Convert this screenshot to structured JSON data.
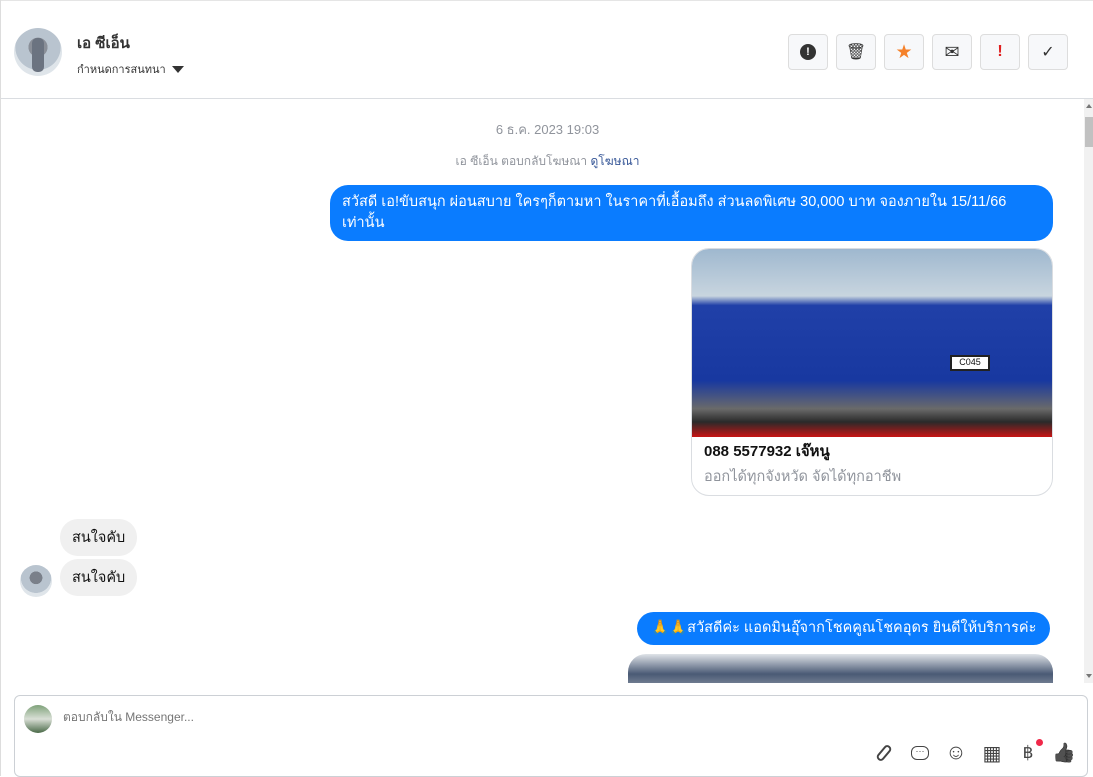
{
  "header": {
    "name": "เอ ซีเอ็น",
    "assign_label": "กำหนดการสนทนา",
    "actions": [
      {
        "icon": "alert-circle-icon",
        "glyph": "❗"
      },
      {
        "icon": "trash-icon",
        "glyph": "🗑"
      },
      {
        "icon": "star-icon",
        "glyph": "★",
        "color": "#f5812a"
      },
      {
        "icon": "envelope-icon",
        "glyph": "✉"
      },
      {
        "icon": "exclamation-icon",
        "glyph": "!",
        "color": "#e02020"
      },
      {
        "icon": "check-icon",
        "glyph": "✓"
      }
    ]
  },
  "chat": {
    "timestamp": "6 ธ.ค. 2023 19:03",
    "ad_reply_text": "เอ ซีเอ็น ตอบกลับโฆษณา",
    "ad_link": "ดูโฆษณา",
    "msg1": "สวัสดี เอ!ขับสนุก ผ่อนสบาย ใครๆก็ตามหา ในราคาที่เอื้อมถึง ส่วนลดพิเศษ 30,000 บาท จองภายใน 15/11/66 เท่านั้น",
    "card": {
      "plate": "C045",
      "title": "088 5577932 เจ๊หนู",
      "subtitle": "ออกได้ทุกจังหวัด จัดได้ทุกอาชีพ"
    },
    "incoming": [
      "สนใจคับ",
      "สนใจคับ"
    ],
    "msg2": "🙏🙏สวัสดีค่ะ แอดมินอุ๊จากโชคคูณโชคอุดร ยินดีให้บริการค่ะ"
  },
  "composer": {
    "placeholder": "ตอบกลับใน Messenger...",
    "tools": [
      {
        "icon": "paperclip-icon",
        "glyph": "📎"
      },
      {
        "icon": "chat-bubble-icon",
        "glyph": "💬"
      },
      {
        "icon": "smiley-icon",
        "glyph": "☺"
      },
      {
        "icon": "table-icon",
        "glyph": "▦"
      },
      {
        "icon": "baht-icon",
        "glyph": "฿"
      },
      {
        "icon": "thumbs-up-icon",
        "glyph": "👍"
      }
    ]
  },
  "colors": {
    "accent": "#0a7cff",
    "notification": "#f02849"
  }
}
